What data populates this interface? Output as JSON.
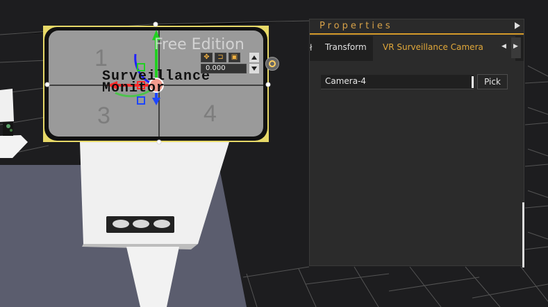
{
  "viewport": {
    "watermark": "Free Edition",
    "monitor_label": "Surveillance Monitor",
    "screen_numbers": [
      "1",
      "3",
      "4"
    ],
    "toolbar": {
      "value": "0.000"
    }
  },
  "properties_panel": {
    "title": "Properties",
    "tabs": [
      "Transform",
      "VR Surveillance Camera"
    ],
    "active_tab": "VR Surveillance Camera",
    "camera_field_value": "Camera-4",
    "pick_button": "Pick"
  },
  "colors": {
    "panel_bg": "#2b2b2b",
    "accent": "#e1a83a",
    "grid": "#555555",
    "floor": "#5b5d6e",
    "selection": "#f2e46d"
  },
  "icons": [
    "collapse-right-icon",
    "tab-left-icon",
    "tab-right-icon",
    "move-tool-icon",
    "rotate-tool-icon",
    "scale-tool-icon",
    "camera-badge-icon",
    "up-arrow-icon",
    "down-arrow-icon"
  ]
}
